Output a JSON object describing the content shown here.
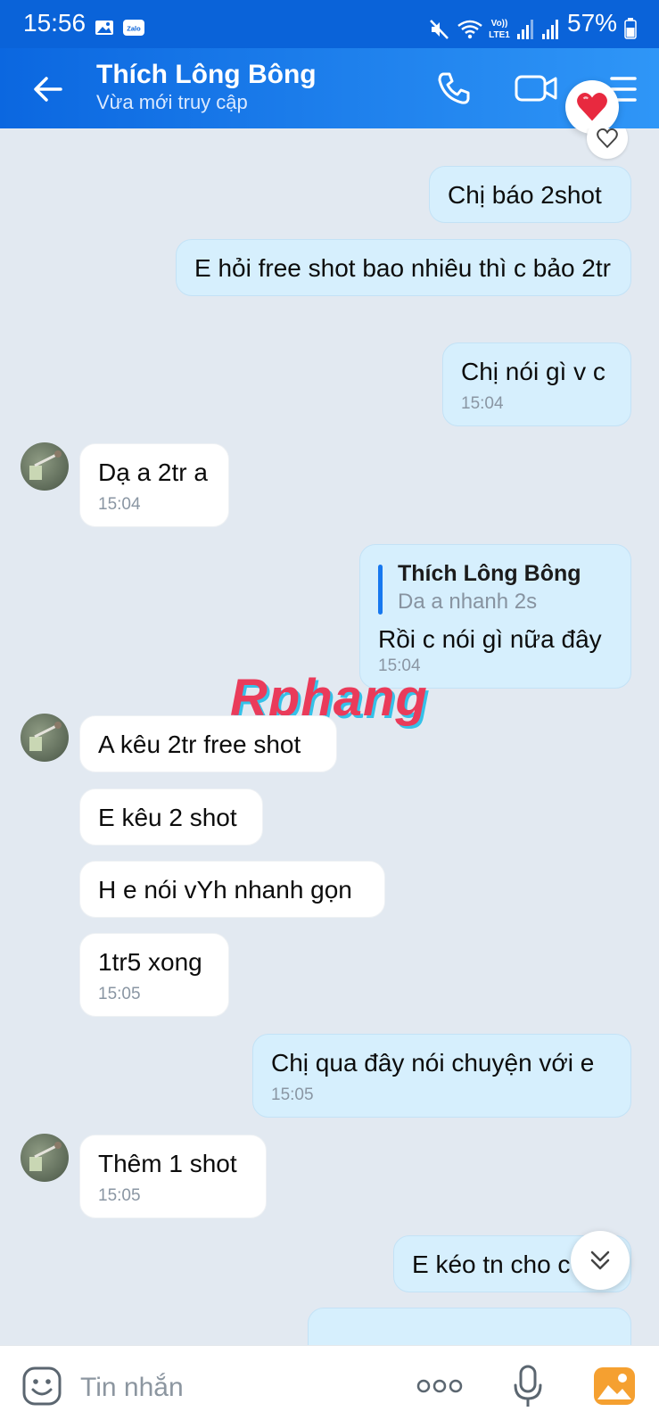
{
  "status_bar": {
    "time": "15:56",
    "volte_label": "Vo)) LTE1",
    "battery": "57%",
    "icons": [
      "image-icon",
      "zalo-icon",
      "mute-icon",
      "wifi-icon",
      "signal-icon",
      "signal-icon",
      "battery-icon"
    ]
  },
  "header": {
    "contact_name": "Thích Lông Bông",
    "contact_status": "Vừa mới truy cập",
    "icons": [
      "back-arrow-icon",
      "phone-icon",
      "video-call-icon",
      "menu-list-icon",
      "heart-icon"
    ]
  },
  "messages": [
    {
      "id": "m1",
      "side": "out",
      "text": "Chị báo 2shot",
      "time": "",
      "reaction": "heart-outline"
    },
    {
      "id": "m2",
      "side": "out",
      "text": "E hỏi free shot bao nhiêu thì c bảo 2tr",
      "time": ""
    },
    {
      "id": "m3",
      "side": "out",
      "text": "Chị nói gì v c",
      "time": "15:04"
    },
    {
      "id": "m4",
      "side": "in",
      "text": "Dạ a 2tr a",
      "time": "15:04"
    },
    {
      "id": "m5",
      "side": "out",
      "quote": {
        "name": "Thích Lông Bông",
        "text": "Da a nhanh 2s"
      },
      "text": "Rồi c nói gì nữa đây",
      "time": "15:04"
    },
    {
      "id": "m6",
      "side": "in",
      "text": "A kêu 2tr free shot",
      "time": ""
    },
    {
      "id": "m7",
      "side": "in",
      "text": "E kêu 2 shot",
      "time": ""
    },
    {
      "id": "m8",
      "side": "in",
      "text": "H e nói vYh nhanh gọn",
      "time": ""
    },
    {
      "id": "m9",
      "side": "in",
      "text": "1tr5 xong",
      "time": "15:05"
    },
    {
      "id": "m10",
      "side": "out",
      "text": "Chị qua đây nói chuyện với e",
      "time": "15:05"
    },
    {
      "id": "m11",
      "side": "in",
      "text": "Thêm 1 shot",
      "time": "15:05"
    },
    {
      "id": "m12",
      "side": "out",
      "text": "E kéo tn cho c",
      "time": ""
    }
  ],
  "watermark": "Rphang",
  "input_bar": {
    "placeholder": "Tin nhắn",
    "icons": [
      "emoji-icon",
      "more-options-icon",
      "microphone-icon",
      "photo-gallery-icon"
    ]
  },
  "colors": {
    "header_start": "#0b67e0",
    "header_end": "#2f96f7",
    "chat_bg": "#e2e9f1",
    "outgoing_bubble": "#d6effd",
    "incoming_bubble": "#ffffff",
    "quote_bar": "#1778ef",
    "heart": "#e8293f"
  }
}
